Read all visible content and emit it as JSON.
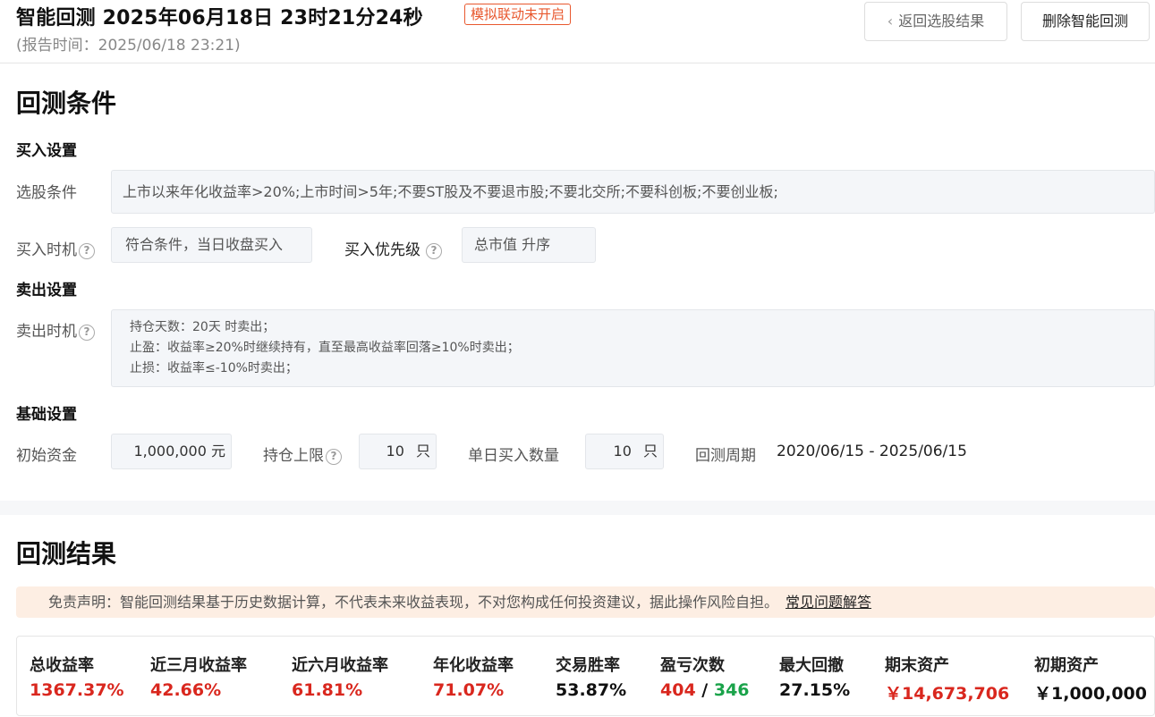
{
  "header": {
    "title": "智能回测  2025年06月18日  23时21分24秒",
    "sim_badge": "模拟联动未开启",
    "report_time": "(报告时间：2025/06/18 23:21)",
    "back_button": "返回选股结果",
    "delete_button": "删除智能回测"
  },
  "conditions": {
    "title": "回测条件",
    "buy_settings": {
      "title": "买入设置",
      "selection_label": "选股条件",
      "selection_value": "上市以来年化收益率>20%;上市时间>5年;不要ST股及不要退市股;不要北交所;不要科创板;不要创业板;",
      "timing_label": "买入时机",
      "timing_value": "符合条件，当日收盘买入",
      "priority_label": "买入优先级",
      "priority_value": "总市值 升序"
    },
    "sell_settings": {
      "title": "卖出设置",
      "timing_label": "卖出时机",
      "lines": [
        "持仓天数：20天 时卖出；",
        "止盈：收益率≥20%时继续持有，直至最高收益率回落≥10%时卖出；",
        "止损：收益率≤-10%时卖出；"
      ]
    },
    "basic_settings": {
      "title": "基础设置",
      "capital_label": "初始资金",
      "capital_value": "1,000,000",
      "capital_unit": "元",
      "position_limit_label": "持仓上限",
      "position_limit_value": "10",
      "position_limit_unit": "只",
      "daily_buy_label": "单日买入数量",
      "daily_buy_value": "10",
      "daily_buy_unit": "只",
      "period_label": "回测周期",
      "period_value": "2020/06/15 - 2025/06/15"
    }
  },
  "results": {
    "title": "回测结果",
    "disclaimer": "免责声明：智能回测结果基于历史数据计算，不代表未来收益表现，不对您构成任何投资建议，据此操作风险自担。",
    "faq_link": "常见问题解答",
    "stats": [
      {
        "label": "总收益率",
        "value": "1367.37%",
        "color": "#d9271e"
      },
      {
        "label": "近三月收益率",
        "value": "42.66%",
        "color": "#d9271e"
      },
      {
        "label": "近六月收益率",
        "value": "61.81%",
        "color": "#d9271e"
      },
      {
        "label": "年化收益率",
        "value": "71.07%",
        "color": "#d9271e"
      },
      {
        "label": "交易胜率",
        "value": "53.87%",
        "color": "#111111"
      },
      {
        "label": "盈亏次数",
        "win": "404",
        "sep": " / ",
        "loss": "346"
      },
      {
        "label": "最大回撤",
        "value": "27.15%",
        "color": "#111111"
      },
      {
        "label": "期末资产",
        "value": "￥14,673,706",
        "color": "#d9271e"
      },
      {
        "label": "初期资产",
        "value": "￥1,000,000",
        "color": "#111111"
      }
    ]
  }
}
